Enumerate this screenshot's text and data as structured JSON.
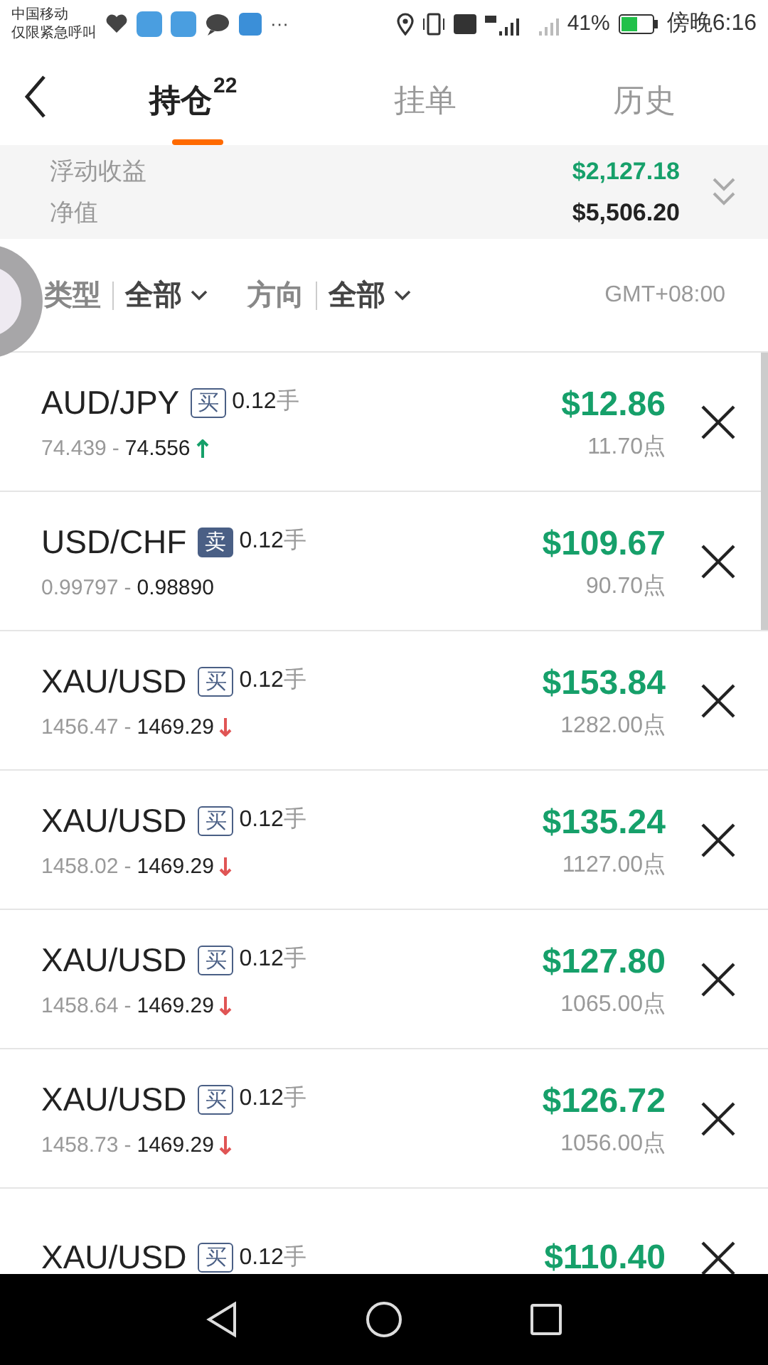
{
  "status_bar": {
    "carrier_lines": [
      "中国移动",
      "仅限紧急呼叫"
    ],
    "more": "···",
    "battery_percent": "41%",
    "time": "傍晚6:16"
  },
  "tabs": [
    {
      "label": "持仓",
      "badge": "22",
      "selected": true
    },
    {
      "label": "挂单",
      "selected": false
    },
    {
      "label": "历史",
      "selected": false
    }
  ],
  "summary": [
    {
      "label": "浮动收益",
      "value": "$2,127.18",
      "kind": "profit"
    },
    {
      "label": "净值",
      "value": "$5,506.20",
      "kind": "plain"
    }
  ],
  "filters": [
    {
      "label": "类型",
      "value": "全部"
    },
    {
      "label": "方向",
      "value": "全部"
    }
  ],
  "timezone": "GMT+08:00",
  "positions": [
    {
      "symbol": "AUD/JPY",
      "side": "买",
      "kind": "buy",
      "lots": "0.12",
      "unit": "手",
      "open": "74.439",
      "dash": "-",
      "current": "74.556",
      "rising": true,
      "profit": "$12.86",
      "points": "11.70点"
    },
    {
      "symbol": "USD/CHF",
      "side": "卖",
      "kind": "sell",
      "lots": "0.12",
      "unit": "手",
      "open": "0.99797",
      "dash": "-",
      "current": "0.98890",
      "profit": "$109.67",
      "points": "90.70点"
    },
    {
      "symbol": "XAU/USD",
      "side": "买",
      "kind": "buy",
      "lots": "0.12",
      "unit": "手",
      "open": "1456.47",
      "dash": "-",
      "current": "1469.29",
      "rising": false,
      "profit": "$153.84",
      "points": "1282.00点"
    },
    {
      "symbol": "XAU/USD",
      "side": "买",
      "kind": "buy",
      "lots": "0.12",
      "unit": "手",
      "open": "1458.02",
      "dash": "-",
      "current": "1469.29",
      "rising": false,
      "profit": "$135.24",
      "points": "1127.00点"
    },
    {
      "symbol": "XAU/USD",
      "side": "买",
      "kind": "buy",
      "lots": "0.12",
      "unit": "手",
      "open": "1458.64",
      "dash": "-",
      "current": "1469.29",
      "rising": false,
      "profit": "$127.80",
      "points": "1065.00点"
    },
    {
      "symbol": "XAU/USD",
      "side": "买",
      "kind": "buy",
      "lots": "0.12",
      "unit": "手",
      "open": "1458.73",
      "dash": "-",
      "current": "1469.29",
      "rising": false,
      "profit": "$126.72",
      "points": "1056.00点"
    },
    {
      "symbol": "XAU/USD",
      "side": "买",
      "kind": "buy",
      "lots": "0.12",
      "unit": "手",
      "profit": "$110.40"
    }
  ]
}
